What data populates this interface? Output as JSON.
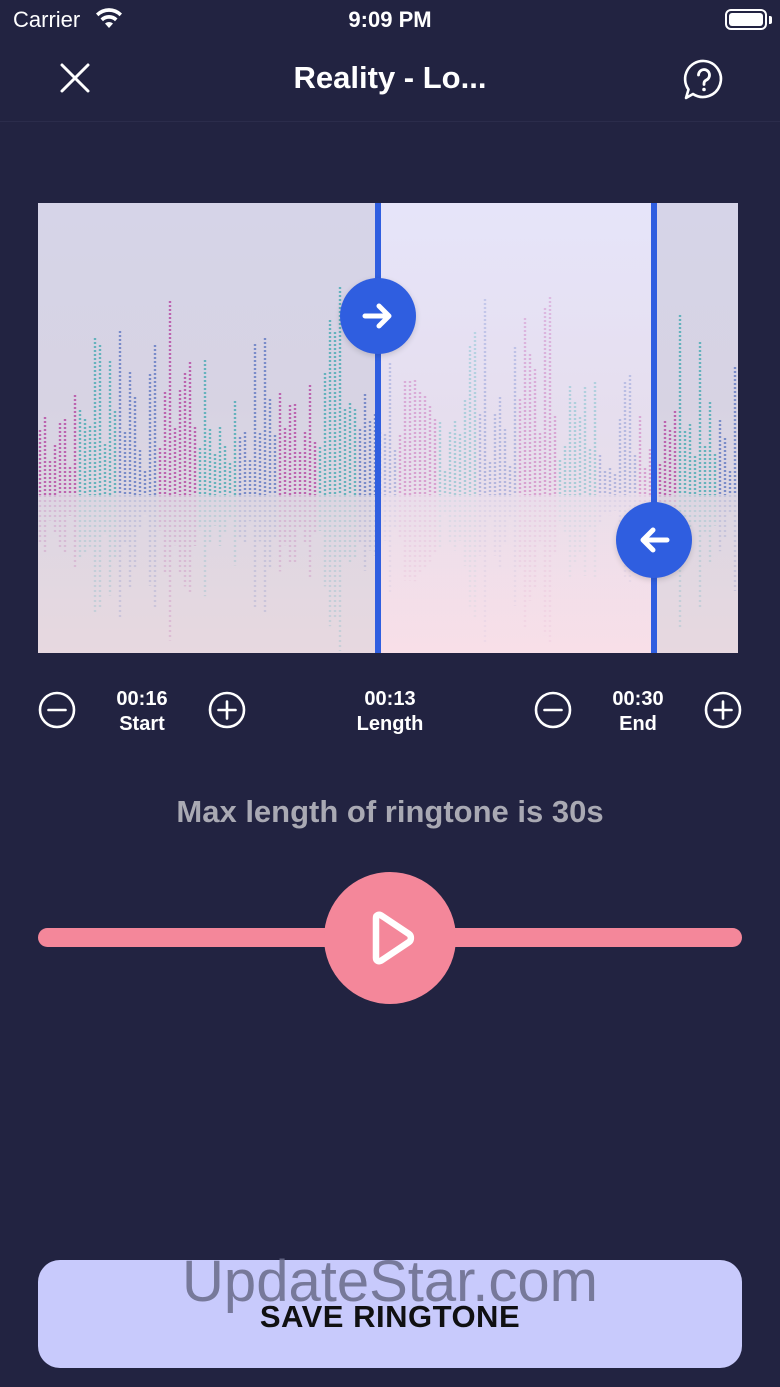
{
  "status_bar": {
    "carrier": "Carrier",
    "time": "9:09 PM"
  },
  "nav": {
    "title": "Reality - Lo...",
    "close_icon": "close-icon",
    "help_icon": "help-bubble-icon"
  },
  "waveform": {
    "selection_start_fraction": 0.486,
    "selection_end_fraction": 0.88,
    "colors": {
      "magenta": "#b3409e",
      "teal": "#3fa8b0",
      "blue": "#5a74c0",
      "handle": "#2f5ee0"
    }
  },
  "controls": {
    "start": {
      "value": "00:16",
      "label": "Start"
    },
    "length": {
      "value": "00:13",
      "label": "Length"
    },
    "end": {
      "value": "00:30",
      "label": "End"
    }
  },
  "max_note": "Max length of ringtone is 30s",
  "player": {
    "progress_fraction": 0.5,
    "accent": "#f4879a"
  },
  "save_button": {
    "label": "SAVE RINGTONE"
  },
  "watermark": "UpdateStar.com"
}
